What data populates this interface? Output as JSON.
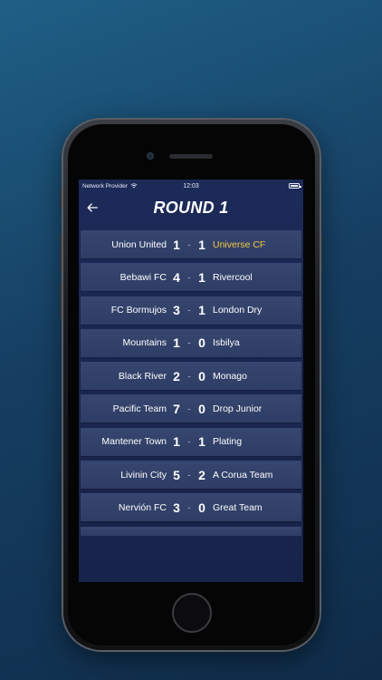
{
  "status_bar": {
    "carrier": "Network Provider",
    "time": "12:03",
    "wifi_icon": "wifi-icon",
    "battery_icon": "battery-icon"
  },
  "header": {
    "back_icon": "arrow-left-icon",
    "title": "ROUND 1"
  },
  "colors": {
    "highlight": "#f3c63f",
    "row_bg": "#36466f",
    "screen_bg": "#1c2a58"
  },
  "matches": [
    {
      "home": "Union United",
      "home_score": "1",
      "separator": "-",
      "away_score": "1",
      "away": "Universe CF",
      "away_highlight": true
    },
    {
      "home": "Bebawi FC",
      "home_score": "4",
      "separator": "-",
      "away_score": "1",
      "away": "Rivercool",
      "away_highlight": false
    },
    {
      "home": "FC Bormujos",
      "home_score": "3",
      "separator": "-",
      "away_score": "1",
      "away": "London Dry",
      "away_highlight": false
    },
    {
      "home": "Mountains",
      "home_score": "1",
      "separator": "-",
      "away_score": "0",
      "away": "Isbilya",
      "away_highlight": false
    },
    {
      "home": "Black River",
      "home_score": "2",
      "separator": "-",
      "away_score": "0",
      "away": "Monago",
      "away_highlight": false
    },
    {
      "home": "Pacific Team",
      "home_score": "7",
      "separator": "-",
      "away_score": "0",
      "away": "Drop Junior",
      "away_highlight": false
    },
    {
      "home": "Mantener Town",
      "home_score": "1",
      "separator": "-",
      "away_score": "1",
      "away": "Plating",
      "away_highlight": false
    },
    {
      "home": "Livinin City",
      "home_score": "5",
      "separator": "-",
      "away_score": "2",
      "away": "A Corua Team",
      "away_highlight": false
    },
    {
      "home": "Nervión FC",
      "home_score": "3",
      "separator": "-",
      "away_score": "0",
      "away": "Great Team",
      "away_highlight": false
    }
  ]
}
